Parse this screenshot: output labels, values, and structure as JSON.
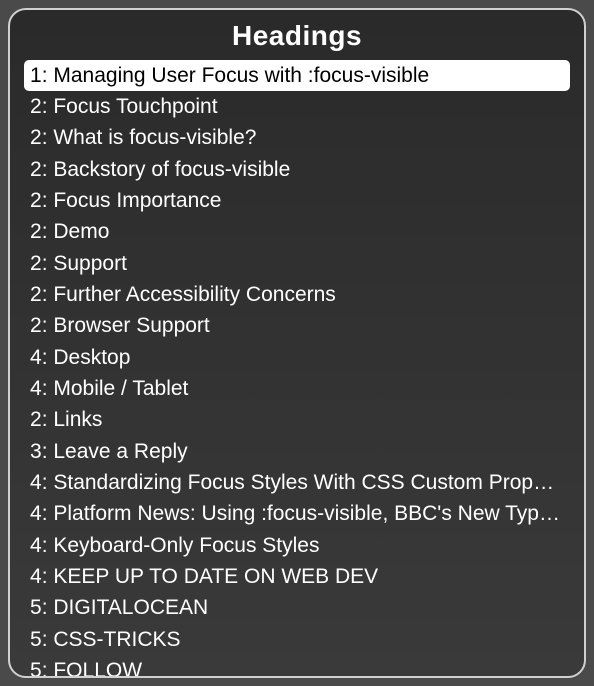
{
  "panel": {
    "title": "Headings"
  },
  "headings": [
    {
      "level": 1,
      "text": "Managing User Focus with :focus-visible",
      "selected": true
    },
    {
      "level": 2,
      "text": "Focus Touchpoint",
      "selected": false
    },
    {
      "level": 2,
      "text": "What is focus-visible?",
      "selected": false
    },
    {
      "level": 2,
      "text": "Backstory of focus-visible",
      "selected": false
    },
    {
      "level": 2,
      "text": "Focus Importance",
      "selected": false
    },
    {
      "level": 2,
      "text": "Demo",
      "selected": false
    },
    {
      "level": 2,
      "text": "Support",
      "selected": false
    },
    {
      "level": 2,
      "text": "Further Accessibility Concerns",
      "selected": false
    },
    {
      "level": 2,
      "text": "Browser Support",
      "selected": false
    },
    {
      "level": 4,
      "text": "Desktop",
      "selected": false
    },
    {
      "level": 4,
      "text": "Mobile / Tablet",
      "selected": false
    },
    {
      "level": 2,
      "text": "Links",
      "selected": false
    },
    {
      "level": 3,
      "text": "Leave a Reply",
      "selected": false
    },
    {
      "level": 4,
      "text": "Standardizing Focus Styles With CSS Custom Properties",
      "selected": false
    },
    {
      "level": 4,
      "text": "Platform News: Using :focus-visible, BBC's New Typography",
      "selected": false
    },
    {
      "level": 4,
      "text": "Keyboard-Only Focus Styles",
      "selected": false
    },
    {
      "level": 4,
      "text": "KEEP UP TO DATE ON WEB DEV",
      "selected": false
    },
    {
      "level": 5,
      "text": "DIGITALOCEAN",
      "selected": false
    },
    {
      "level": 5,
      "text": "CSS-TRICKS",
      "selected": false
    },
    {
      "level": 5,
      "text": "FOLLOW",
      "selected": false
    }
  ]
}
